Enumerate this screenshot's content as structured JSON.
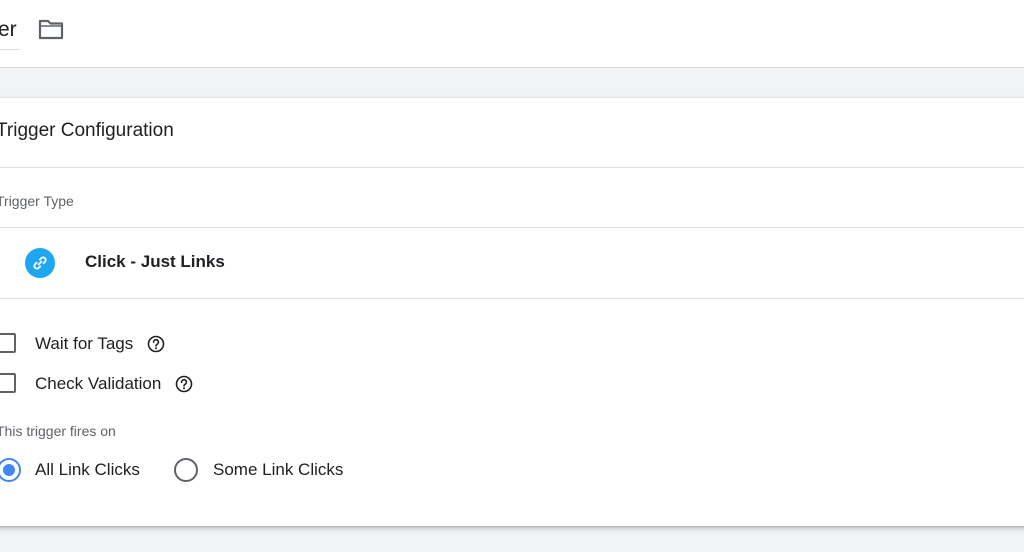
{
  "header": {
    "trigger_name": "er",
    "folder_icon": "folder-icon"
  },
  "card": {
    "title": "Trigger Configuration",
    "trigger_type_label": "Trigger Type",
    "trigger_type": {
      "name": "Click - Just Links",
      "icon": "link-icon",
      "icon_color": "#1ea7f0"
    },
    "options": [
      {
        "label": "Wait for Tags",
        "checked": false,
        "help_icon": "help-icon"
      },
      {
        "label": "Check Validation",
        "checked": false,
        "help_icon": "help-icon"
      }
    ],
    "fires_on_label": "This trigger fires on",
    "fires_on_options": [
      {
        "label": "All Link Clicks",
        "selected": true
      },
      {
        "label": "Some Link Clicks",
        "selected": false
      }
    ],
    "accent_color": "#4285f4"
  }
}
